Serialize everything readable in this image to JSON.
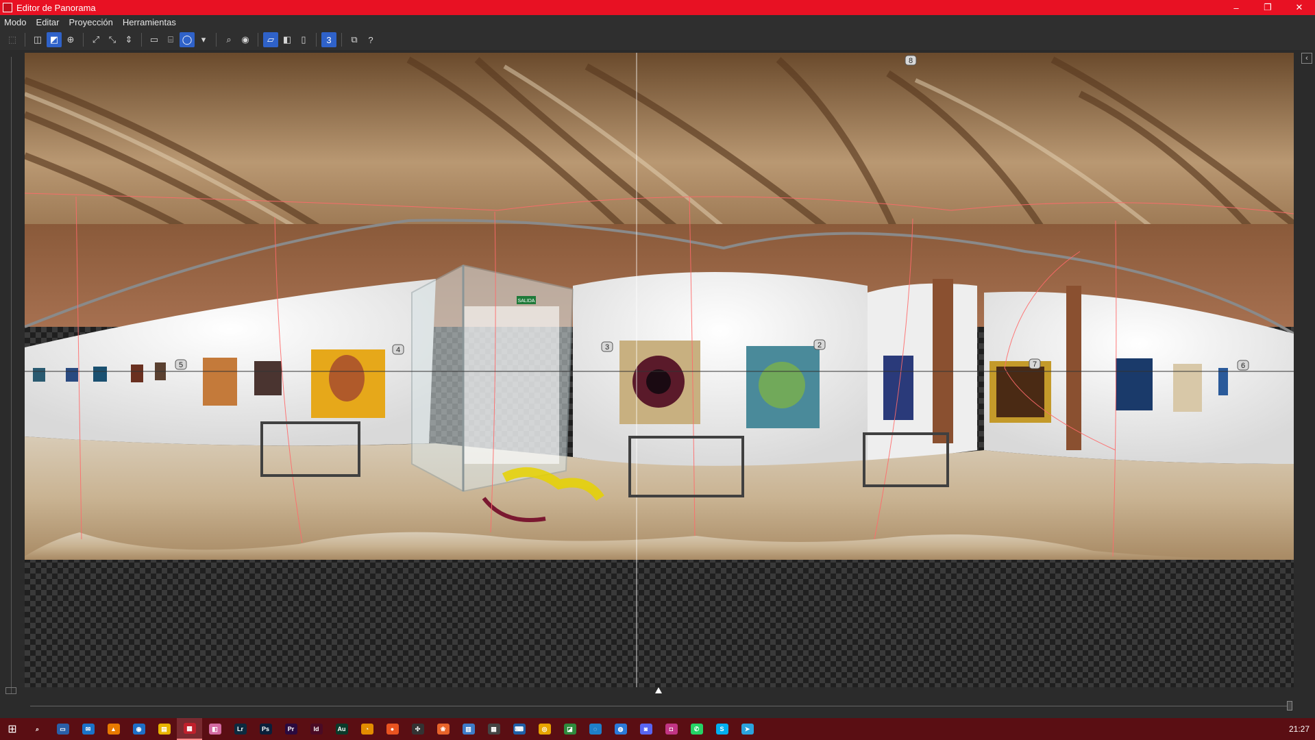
{
  "window": {
    "title": "Editor de Panorama",
    "minimize": "–",
    "maximize": "❐",
    "close": "✕"
  },
  "menu": {
    "items": [
      "Modo",
      "Editar",
      "Proyección",
      "Herramientas"
    ]
  },
  "toolbar": {
    "icons": [
      "select-icon",
      "layers-icon",
      "warp-icon",
      "crosshair-icon",
      "expand-icon",
      "compress-icon",
      "align-center-icon",
      "rectangle-icon",
      "cylinder-icon",
      "sphere-icon",
      "dropdown-arrow-icon",
      "zoom-icon",
      "eye-icon",
      "view-single-icon",
      "view-split-icon",
      "view-mirror-icon",
      "count-badge-icon",
      "overlay-icon",
      "help-icon"
    ],
    "count_badge": "3"
  },
  "panorama": {
    "markers": [
      "8",
      "5",
      "4",
      "3",
      "2",
      "7",
      "6"
    ],
    "exit_sign": "SALIDA"
  },
  "taskbar": {
    "apps": [
      {
        "name": "search-icon",
        "glyph": "⌕",
        "color": "#5a0e13"
      },
      {
        "name": "desktop-icon",
        "glyph": "▭",
        "color": "#2a5fa8"
      },
      {
        "name": "mail-icon",
        "glyph": "✉",
        "color": "#1a73c9"
      },
      {
        "name": "vlc-icon",
        "glyph": "▲",
        "color": "#e87a00"
      },
      {
        "name": "network-icon",
        "glyph": "◉",
        "color": "#1e6fc7"
      },
      {
        "name": "explorer-icon",
        "glyph": "▤",
        "color": "#e8b400"
      },
      {
        "name": "panorama-app-icon",
        "glyph": "▦",
        "color": "#c0202c"
      },
      {
        "name": "photos-icon",
        "glyph": "◧",
        "color": "#d36aa2"
      },
      {
        "name": "lightroom-icon",
        "glyph": "Lr",
        "color": "#0c2a3f"
      },
      {
        "name": "photoshop-icon",
        "glyph": "Ps",
        "color": "#0a1f3a"
      },
      {
        "name": "premiere-icon",
        "glyph": "Pr",
        "color": "#2a0a3f"
      },
      {
        "name": "indesign-icon",
        "glyph": "Id",
        "color": "#4a0a24"
      },
      {
        "name": "audition-icon",
        "glyph": "Au",
        "color": "#0a3a2a"
      },
      {
        "name": "sync-icon",
        "glyph": "◔",
        "color": "#e38d00"
      },
      {
        "name": "ubuntu-icon",
        "glyph": "●",
        "color": "#e95420"
      },
      {
        "name": "davinci-icon",
        "glyph": "✣",
        "color": "#333333"
      },
      {
        "name": "fox-icon",
        "glyph": "❀",
        "color": "#e8642a"
      },
      {
        "name": "document-icon",
        "glyph": "▥",
        "color": "#3d7cc9"
      },
      {
        "name": "calculator-icon",
        "glyph": "▦",
        "color": "#444444"
      },
      {
        "name": "keyboard-icon",
        "glyph": "⌨",
        "color": "#1e5fa8"
      },
      {
        "name": "chrome-icon",
        "glyph": "◎",
        "color": "#e8a400"
      },
      {
        "name": "maps-icon",
        "glyph": "◪",
        "color": "#2e8b3d"
      },
      {
        "name": "edge-icon",
        "glyph": "◌",
        "color": "#1e7fc9"
      },
      {
        "name": "chat-icon",
        "glyph": "◍",
        "color": "#2b7ad9"
      },
      {
        "name": "discord-icon",
        "glyph": "◙",
        "color": "#5865f2"
      },
      {
        "name": "instagram-icon",
        "glyph": "◘",
        "color": "#c13584"
      },
      {
        "name": "whatsapp-icon",
        "glyph": "✆",
        "color": "#25d366"
      },
      {
        "name": "skype-icon",
        "glyph": "S",
        "color": "#00aff0"
      },
      {
        "name": "telegram-icon",
        "glyph": "➤",
        "color": "#2aa3de"
      }
    ],
    "clock": "21:27"
  }
}
